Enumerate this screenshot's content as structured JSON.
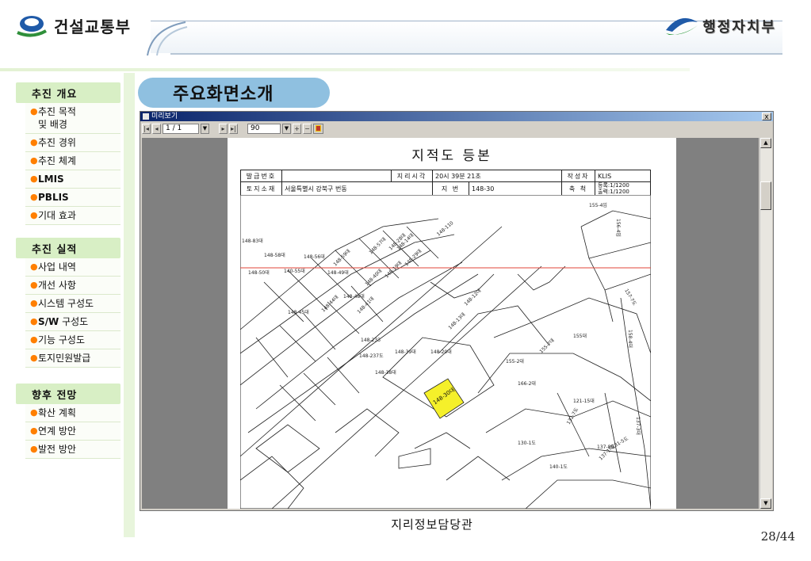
{
  "header": {
    "left_logo_text": "건설교통부",
    "right_logo_text": "행정자치부"
  },
  "sidebar": {
    "sections": [
      {
        "title": "추진 개요",
        "items": [
          {
            "label": "추진 목적\n및 배경",
            "bold": false
          },
          {
            "label": "추진 경위",
            "bold": false
          },
          {
            "label": "추진 체계",
            "bold": false
          },
          {
            "label": "LMIS",
            "bold": true
          },
          {
            "label": "PBLIS",
            "bold": true
          },
          {
            "label": "기대 효과",
            "bold": false
          }
        ]
      },
      {
        "title": "추진 실적",
        "items": [
          {
            "label": "사업 내역",
            "bold": false
          },
          {
            "label": "개선 사항",
            "bold": false
          },
          {
            "label": "시스템 구성도",
            "bold": false
          },
          {
            "label": "S/W 구성도",
            "bold": false,
            "bold_prefix": "S/W"
          },
          {
            "label": "기능 구성도",
            "bold": false
          },
          {
            "label": "토지민원발급",
            "bold": false
          }
        ]
      },
      {
        "title": "향후 전망",
        "items": [
          {
            "label": "확산 계획",
            "bold": false
          },
          {
            "label": "연계 방안",
            "bold": false
          },
          {
            "label": "발전 방안",
            "bold": false
          }
        ]
      }
    ]
  },
  "page_title": "주요화면소개",
  "preview_window": {
    "title": "미리보기",
    "close_label": "x",
    "toolbar": {
      "first": "|◂",
      "prev": "◂",
      "page_value": "1 / 1",
      "next": "▸",
      "last": "▸|",
      "zoom_value": "90",
      "zoom_in": "+",
      "zoom_out": "−",
      "dropdown_arrow": "▼"
    },
    "scroll_up": "▲",
    "scroll_down": "▼"
  },
  "document": {
    "title": "지적도 등본",
    "row1": {
      "label1": "발급번호",
      "value1": "",
      "label2": "지리시각",
      "value2": "20시 39분 21초",
      "label3": "작성자",
      "value3": "KLIS"
    },
    "row2": {
      "label1": "토지소재",
      "value1": "서울특별시 강북구 번동",
      "label2": "지 번",
      "value2": "148-30",
      "label3": "축 척",
      "value3a": "등록:1/1200",
      "value3b": "출력:1/1200"
    },
    "parcels": [
      "148-83대",
      "148-58대",
      "148-56대",
      "148-59대",
      "148-57대",
      "148-14대",
      "148-110",
      "148-50대",
      "140-55대",
      "148-49대",
      "148-48대",
      "148-40대",
      "148-45대",
      "148-44대",
      "148-41대",
      "148-39대",
      "148-38대",
      "148-30대",
      "148-20대",
      "148-13대",
      "148-12대",
      "148-19대",
      "148-28대",
      "148-29대",
      "148-233",
      "148-237도",
      "155대",
      "155-4임",
      "155-2대",
      "155-7대",
      "156-4임",
      "166-2대",
      "121-15대",
      "130-1도",
      "140-1도",
      "137-8도",
      "137-1대",
      "132-7도",
      "137-3대",
      "131-5도",
      "158-4대",
      "157-7도"
    ],
    "highlight_parcel": "148-30대"
  },
  "footer": {
    "department": "지리정보담당관",
    "page_number": "28/44"
  },
  "colors": {
    "sidebar_header_bg": "#d8efc5",
    "bullet": "#ff7f00",
    "title_pill": "#8fc0e0",
    "highlight_parcel": "#f5f02a",
    "reference_line": "#e0453a"
  }
}
